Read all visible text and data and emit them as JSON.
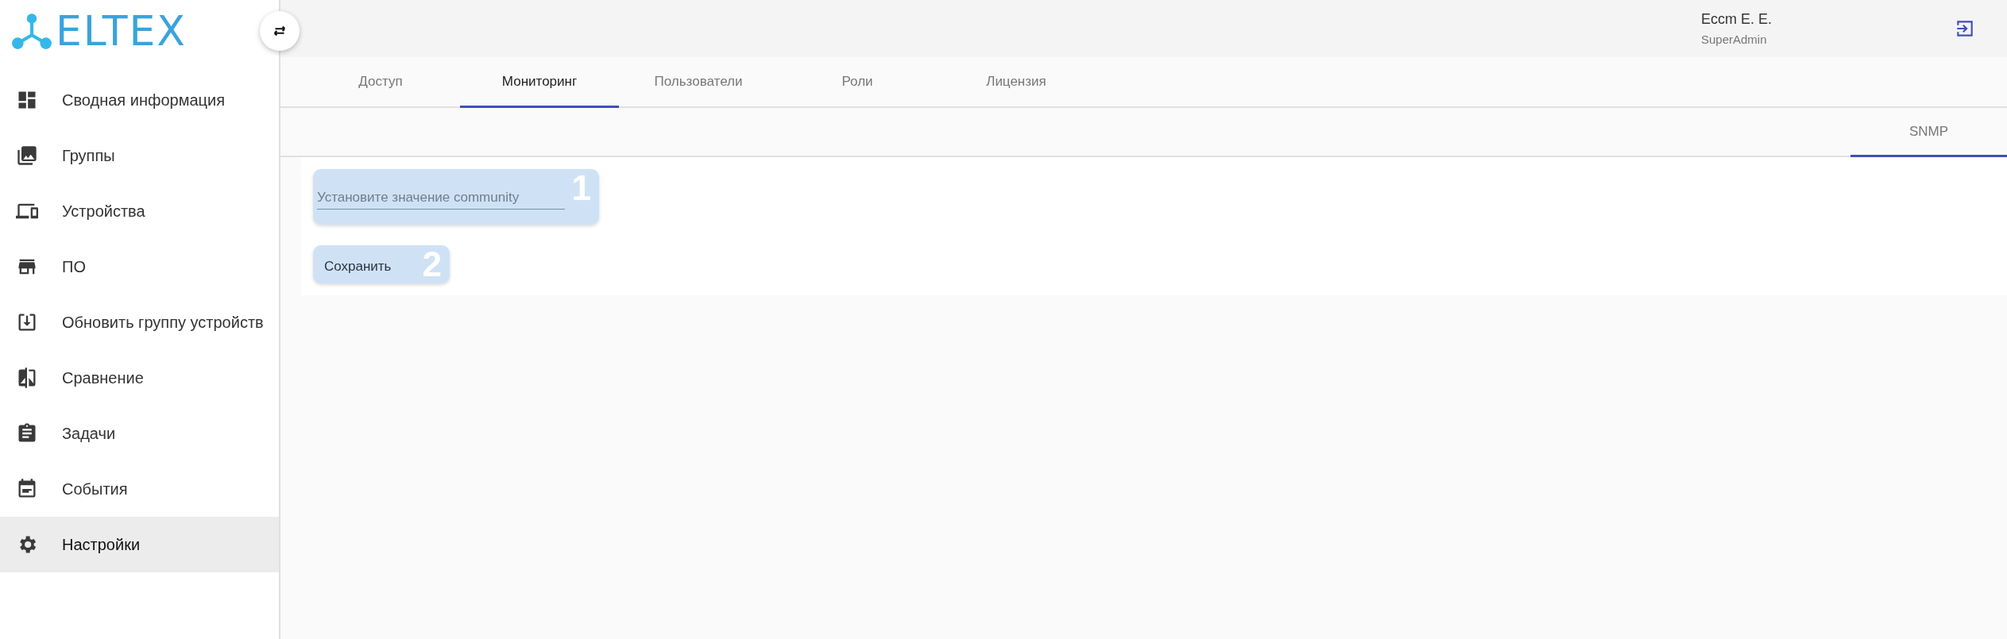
{
  "logo": {
    "text": "ELTEX"
  },
  "sidebar": {
    "items": [
      {
        "label": "Сводная информация",
        "selected": false
      },
      {
        "label": "Группы",
        "selected": false
      },
      {
        "label": "Устройства",
        "selected": false
      },
      {
        "label": "ПО",
        "selected": false
      },
      {
        "label": "Обновить группу устройств",
        "selected": false
      },
      {
        "label": "Сравнение",
        "selected": false
      },
      {
        "label": "Задачи",
        "selected": false
      },
      {
        "label": "События",
        "selected": false
      },
      {
        "label": "Настройки",
        "selected": true
      }
    ]
  },
  "header": {
    "user_name": "Eccm E. E.",
    "user_role": "SuperAdmin"
  },
  "tabs": [
    {
      "label": "Доступ",
      "selected": false
    },
    {
      "label": "Мониторинг",
      "selected": true
    },
    {
      "label": "Пользователи",
      "selected": false
    },
    {
      "label": "Роли",
      "selected": false
    },
    {
      "label": "Лицензия",
      "selected": false
    }
  ],
  "subtabs": [
    {
      "label": "SNMP",
      "selected": true
    }
  ],
  "form": {
    "community_field": {
      "placeholder": "Установите значение community",
      "marker": "1"
    },
    "save_button": {
      "label": "Сохранить",
      "marker": "2"
    }
  }
}
